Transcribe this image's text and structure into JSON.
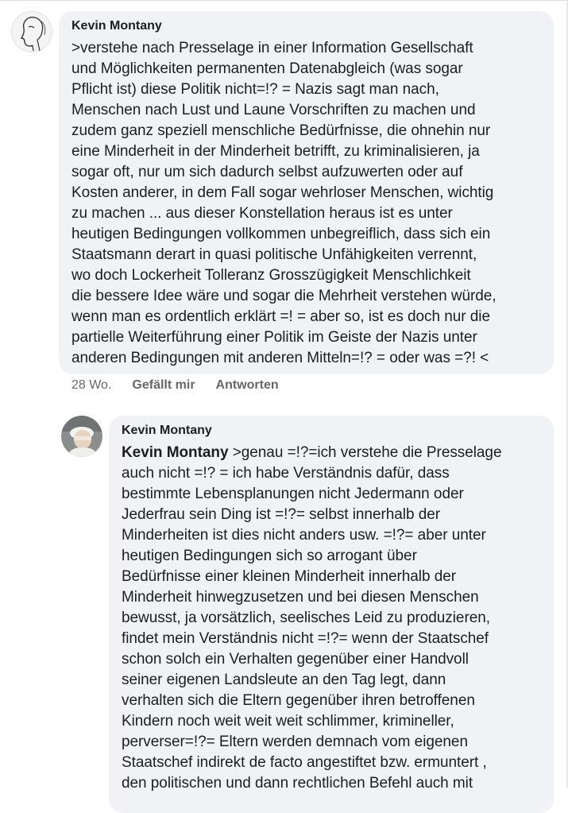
{
  "comment1": {
    "author": "Kevin Montany",
    "text": ">verstehe nach Presselage in einer Information Gesellschaft\nund Möglichkeiten permanenten Datenabgleich (was sogar\nPflicht ist) diese Politik nicht=!? = Nazis sagt man nach,\nMenschen  nach Lust und Laune Vorschriften zu machen und\nzudem ganz speziell menschliche Bedürfnisse, die ohnehin nur\neine Minderheit in der Minderheit betrifft, zu kriminalisieren, ja\nsogar oft, nur um sich dadurch selbst aufzuwerten oder auf\nKosten anderer, in dem Fall sogar wehrloser Menschen, wichtig\nzu machen ... aus dieser Konstellation heraus ist es unter\nheutigen Bedingungen vollkommen unbegreiflich, dass sich ein\nStaatsmann derart in quasi politische Unfähigkeiten   verrennt,\nwo doch Lockerheit Tolleranz Grosszügigkeit Menschlichkeit\ndie bessere Idee wäre und sogar die Mehrheit verstehen würde,\nwenn man es ordentlich erklärt =! = aber so, ist es doch nur die\npartielle Weiterführung einer Politik im Geiste der Nazis unter\nanderen Bedingungen mit anderen Mitteln=!? = oder was =?! <",
    "time": "28 Wo.",
    "like_label": "Gefällt mir",
    "reply_label": "Antworten"
  },
  "comment2": {
    "author": "Kevin Montany",
    "mention": "Kevin Montany",
    "text": " >genau =!?=ich verstehe die Presselage\nauch nicht =!? = ich habe Verständnis dafür, dass\nbestimmte Lebensplanungen nicht Jedermann oder\nJederfrau sein Ding ist =!?= selbst innerhalb der\nMinderheiten ist dies nicht anders usw. =!?= aber  unter\nheutigen Bedingungen sich so arrogant über\nBedürfnisse einer kleinen Minderheit innerhalb der\nMinderheit hinwegzusetzen und bei diesen Menschen\nbewusst, ja  vorsätzlich, seelisches Leid zu produzieren,\nfindet mein Verständnis nicht =!?= wenn der Staatschef\nschon solch ein Verhalten gegenüber einer Handvoll\nseiner eigenen  Landsleute an den Tag legt, dann\nverhalten sich die Eltern gegenüber ihren betroffenen\nKindern noch weit weit weit schlimmer, krimineller,\nperverser=!?= Eltern werden demnach vom eigenen\nStaatschef indirekt de facto angestiftet bzw. ermuntert ,\nden politischen und dann rechtlichen Befehl auch mit"
  }
}
